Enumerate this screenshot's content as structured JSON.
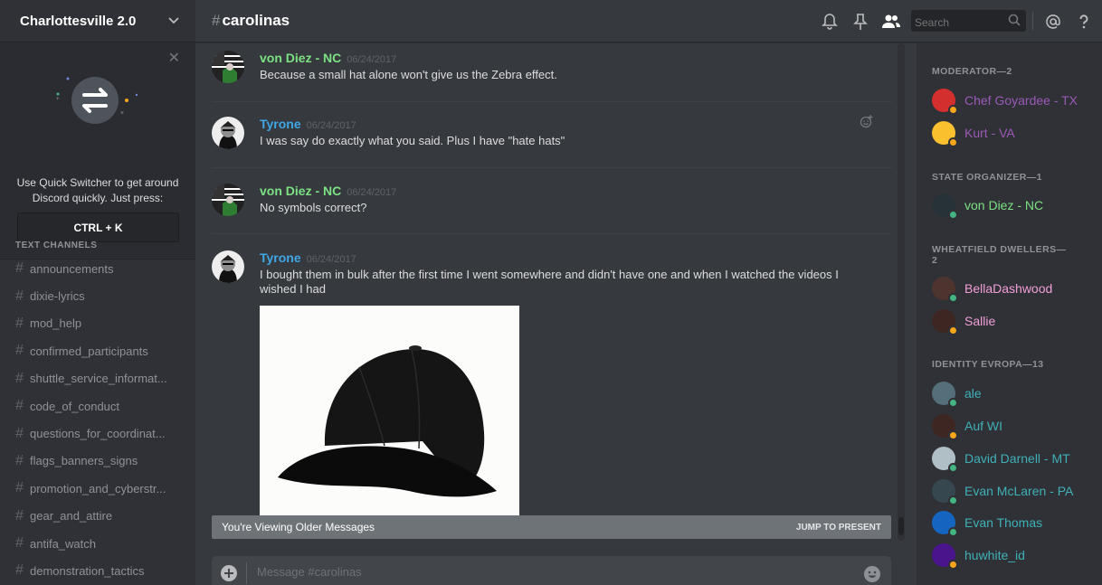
{
  "server": {
    "name": "Charlottesville 2.0"
  },
  "quick_switcher": {
    "text_line1": "Use Quick Switcher to get around",
    "text_line2": "Discord quickly. Just press:",
    "shortcut": "CTRL + K"
  },
  "channels_category": "TEXT CHANNELS",
  "channels": [
    "announcements",
    "dixie-lyrics",
    "mod_help",
    "confirmed_participants",
    "shuttle_service_informat...",
    "code_of_conduct",
    "questions_for_coordinat...",
    "flags_banners_signs",
    "promotion_and_cyberstr...",
    "gear_and_attire",
    "antifa_watch",
    "demonstration_tactics"
  ],
  "header": {
    "hash": "#",
    "channel": "carolinas",
    "search_placeholder": "Search"
  },
  "messages": [
    {
      "author": "von Diez - NC",
      "time": "06/24/2017",
      "text": "Because a small hat alone won't give us the Zebra effect.",
      "color": "#7be183"
    },
    {
      "author": "Tyrone",
      "time": "06/24/2017",
      "text": "I was say do exactly what you said. Plus I have \"hate hats\"",
      "color": "#3fa7e6"
    },
    {
      "author": "von Diez - NC",
      "time": "06/24/2017",
      "text": "No symbols correct?",
      "color": "#7be183"
    },
    {
      "author": "Tyrone",
      "time": "06/24/2017",
      "text": "I bought them in bulk after the first time I went somewhere and didn't have one and when I watched the videos I wished I had",
      "color": "#3fa7e6"
    }
  ],
  "older_bar": {
    "label": "You're Viewing Older Messages",
    "action": "JUMP TO PRESENT"
  },
  "composer": {
    "placeholder": "Message #carolinas"
  },
  "roles": [
    {
      "label": "MODERATOR—2"
    },
    {
      "label": "STATE ORGANIZER—1"
    },
    {
      "label": "WHEATFIELD DWELLERS—2"
    },
    {
      "label": "IDENTITY EVROPA—13"
    }
  ],
  "members": [
    {
      "name": "Chef Goyardee - TX",
      "color": "#9b59b6",
      "status": "#faa61a"
    },
    {
      "name": "Kurt - VA",
      "color": "#9b59b6",
      "status": "#faa61a"
    },
    {
      "name": "von Diez - NC",
      "color": "#7be183",
      "status": "#43b581"
    },
    {
      "name": "BellaDashwood",
      "color": "#f29fd8",
      "status": "#43b581"
    },
    {
      "name": "Sallie",
      "color": "#f29fd8",
      "status": "#faa61a"
    },
    {
      "name": "ale",
      "color": "#3fb0b7",
      "status": "#43b581"
    },
    {
      "name": "Auf WI",
      "color": "#3fb0b7",
      "status": "#faa61a"
    },
    {
      "name": "David Darnell - MT",
      "color": "#3fb0b7",
      "status": "#43b581"
    },
    {
      "name": "Evan McLaren - PA",
      "color": "#3fb0b7",
      "status": "#43b581"
    },
    {
      "name": "Evan Thomas",
      "color": "#3fb0b7",
      "status": "#43b581"
    },
    {
      "name": "huwhite_id",
      "color": "#3fb0b7",
      "status": "#faa61a"
    }
  ]
}
